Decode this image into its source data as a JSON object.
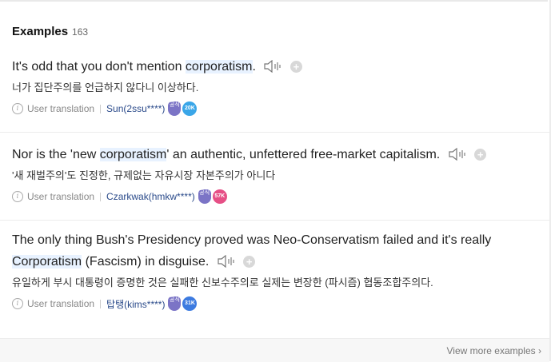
{
  "examples_section": {
    "title": "Examples",
    "count": "163",
    "items": [
      {
        "en_before": "It's odd that you don't mention ",
        "en_highlight": "corporatism",
        "en_after": ".",
        "ko": "너가 집단주의를 언급하지 않다니 이상하다.",
        "source_label": "User translation",
        "user": "Sun(2ssu****)",
        "level_badge": "20K",
        "level_color": "#3aa6e8"
      },
      {
        "en_before": "Nor is the 'new ",
        "en_highlight": "corporatism",
        "en_after": "' an authentic, unfettered free-market capitalism.",
        "ko": "'새 재벌주의'도 진정한, 규제없는 자유시장 자본주의가 아니다",
        "source_label": "User translation",
        "user": "Czarkwak(hmkw****)",
        "level_badge": "57K",
        "level_color": "#e64f86"
      },
      {
        "en_before": "The only thing Bush's Presidency proved was Neo-Conservatism failed and it's really ",
        "en_highlight": "Corporatism",
        "en_after": " (Fascism) in disguise.",
        "ko": "유일하게 부시 대통령이 증명한 것은 실패한 신보수주의로 실제는 변장한 (파시즘) 협동조합주의다.",
        "source_label": "User translation",
        "user": "탑탱(kims****)",
        "level_badge": "31K",
        "level_color": "#3d7be0"
      }
    ],
    "shield_text": "공식",
    "view_more": "View more examples"
  }
}
